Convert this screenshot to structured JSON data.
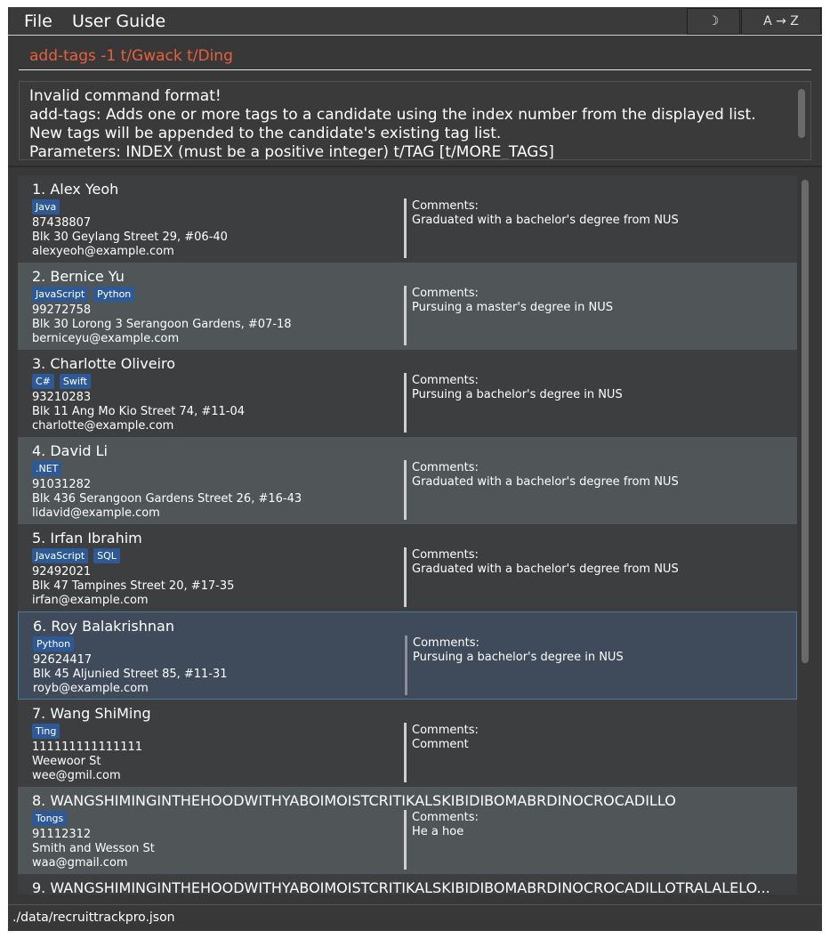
{
  "menu": {
    "file": "File",
    "user_guide": "User Guide"
  },
  "toolbar": {
    "theme_icon": "☽",
    "sort_label": "A → Z"
  },
  "command": {
    "value": "add-tags -1 t/Gwack t/Ding"
  },
  "result": {
    "lines": [
      "Invalid command format!",
      "add-tags: Adds one or more tags to a candidate using the index number from the displayed list.",
      "New tags will be appended to the candidate's existing tag list.",
      "Parameters: INDEX (must be a positive integer) t/TAG [t/MORE_TAGS]"
    ]
  },
  "candidates": [
    {
      "name": "1. Alex Yeoh",
      "tags": [
        "Java"
      ],
      "phone": "87438807",
      "address": "Blk 30 Geylang Street 29, #06-40",
      "email": "alexyeoh@example.com",
      "comments_label": "Comments:",
      "comment": "Graduated with a bachelor's degree from NUS"
    },
    {
      "name": "2. Bernice Yu",
      "tags": [
        "JavaScript",
        "Python"
      ],
      "phone": "99272758",
      "address": "Blk 30 Lorong 3 Serangoon Gardens, #07-18",
      "email": "berniceyu@example.com",
      "comments_label": "Comments:",
      "comment": "Pursuing a master's degree in NUS"
    },
    {
      "name": "3. Charlotte Oliveiro",
      "tags": [
        "C#",
        "Swift"
      ],
      "phone": "93210283",
      "address": "Blk 11 Ang Mo Kio Street 74, #11-04",
      "email": "charlotte@example.com",
      "comments_label": "Comments:",
      "comment": "Pursuing a bachelor's degree in NUS"
    },
    {
      "name": "4. David Li",
      "tags": [
        ".NET"
      ],
      "phone": "91031282",
      "address": "Blk 436 Serangoon Gardens Street 26, #16-43",
      "email": "lidavid@example.com",
      "comments_label": "Comments:",
      "comment": "Graduated with a bachelor's degree from NUS"
    },
    {
      "name": "5. Irfan Ibrahim",
      "tags": [
        "JavaScript",
        "SQL"
      ],
      "phone": "92492021",
      "address": "Blk 47 Tampines Street 20, #17-35",
      "email": "irfan@example.com",
      "comments_label": "Comments:",
      "comment": "Graduated with a bachelor's degree from NUS"
    },
    {
      "name": "6. Roy Balakrishnan",
      "tags": [
        "Python"
      ],
      "phone": "92624417",
      "address": "Blk 45 Aljunied Street 85, #11-31",
      "email": "royb@example.com",
      "comments_label": "Comments:",
      "comment": "Pursuing a bachelor's degree in NUS",
      "selected": true
    },
    {
      "name": "7. Wang ShiMing",
      "tags": [
        "Ting"
      ],
      "phone": "111111111111111",
      "address": "Weewoor St",
      "email": "wee@gmil.com",
      "comments_label": "Comments:",
      "comment": "Comment"
    },
    {
      "name": "8. WANGSHIMINGINTHEHOODWITHYABOIMOISTCRITIKALSKIBIDIBOMABRDINOCROCADILLO",
      "tags": [
        "Tongs"
      ],
      "phone": "91112312",
      "address": "Smith and Wesson St",
      "email": "waa@gmail.com",
      "comments_label": "Comments:",
      "comment": "He a hoe"
    },
    {
      "name": "9. WANGSHIMINGINTHEHOODWITHYABOIMOISTCRITIKALSKIBIDIBOMABRDINOCROCADILLOTRALALELO...",
      "tags": [],
      "phone": "",
      "address": "",
      "email": "",
      "comments_label": "",
      "comment": ""
    }
  ],
  "status": {
    "file_path": "./data/recruittrackpro.json"
  }
}
